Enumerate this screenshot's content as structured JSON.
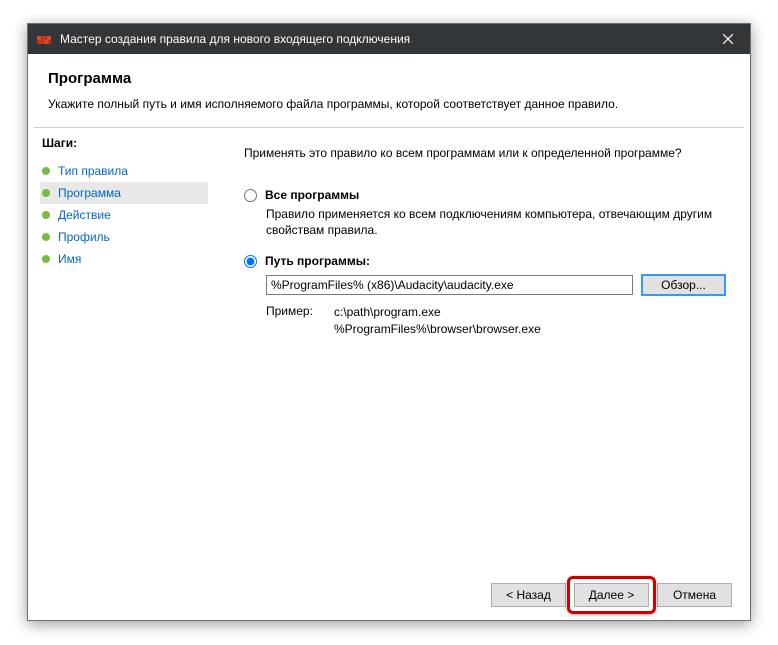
{
  "titlebar": {
    "title": "Мастер создания правила для нового входящего подключения"
  },
  "header": {
    "heading": "Программа",
    "subheading": "Укажите полный путь и имя исполняемого файла программы, которой соответствует данное правило."
  },
  "sidebar": {
    "steps_label": "Шаги:",
    "steps": [
      {
        "label": "Тип правила"
      },
      {
        "label": "Программа"
      },
      {
        "label": "Действие"
      },
      {
        "label": "Профиль"
      },
      {
        "label": "Имя"
      }
    ]
  },
  "content": {
    "prompt": "Применять это правило ко всем программам или к определенной программе?",
    "opt_all": {
      "label": "Все программы",
      "desc": "Правило применяется ко всем подключениям компьютера, отвечающим другим свойствам правила."
    },
    "opt_path": {
      "label": "Путь программы:",
      "value": "%ProgramFiles% (x86)\\Audacity\\audacity.exe",
      "browse": "Обзор..."
    },
    "example": {
      "label": "Пример:",
      "line1": "c:\\path\\program.exe",
      "line2": "%ProgramFiles%\\browser\\browser.exe"
    }
  },
  "footer": {
    "back": "< Назад",
    "next": "Далее >",
    "cancel": "Отмена"
  }
}
